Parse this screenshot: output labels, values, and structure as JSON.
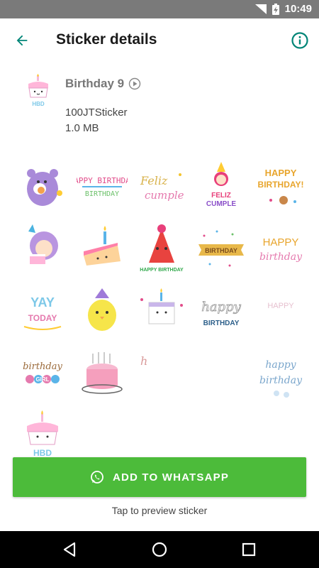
{
  "status_bar": {
    "time": "10:49",
    "icons": [
      "wifi-icon",
      "battery-charging-icon"
    ]
  },
  "app_bar": {
    "title": "Sticker details",
    "back_icon": "arrow-back-icon",
    "info_icon": "info-icon"
  },
  "pack": {
    "name": "Birthday 9",
    "publisher": "100JTSticker",
    "size": "1.0 MB",
    "icon": "hbd-cake-icon"
  },
  "stickers": [
    {
      "name": "sticker-purple-bear"
    },
    {
      "name": "sticker-happy-birthday-rainbow",
      "text": "HAPPY BIRTHDAY"
    },
    {
      "name": "sticker-feliz-cumple-script",
      "text": "Feliz cumple"
    },
    {
      "name": "sticker-girl-feliz-cumple",
      "text": "FELIZ CUMPLE"
    },
    {
      "name": "sticker-happy-birthday-gold",
      "text": "HAPPY BIRTHDAY!"
    },
    {
      "name": "sticker-girl-with-cake"
    },
    {
      "name": "sticker-cake-slice"
    },
    {
      "name": "sticker-party-hat",
      "text": "HAPPY BIRTHDAY"
    },
    {
      "name": "sticker-birthday-banner",
      "text": "BIRTHDAY"
    },
    {
      "name": "sticker-happy-birthday-script",
      "text": "HAPPY birthday"
    },
    {
      "name": "sticker-yay-today",
      "text": "YAY TODAY"
    },
    {
      "name": "sticker-yellow-chick"
    },
    {
      "name": "sticker-cute-cake"
    },
    {
      "name": "sticker-happy-birthday-outline",
      "text": "happy BIRTHDAY"
    },
    {
      "name": "sticker-happy-faint",
      "text": "HAPPY"
    },
    {
      "name": "sticker-birthday-girl",
      "text": "birthday GIRL"
    },
    {
      "name": "sticker-pink-cake-candles"
    },
    {
      "name": "sticker-h-scribble",
      "text": "h"
    },
    {
      "name": "sticker-blank"
    },
    {
      "name": "sticker-happy-birthday-blue",
      "text": "happy birthday"
    },
    {
      "name": "sticker-hbd-cake",
      "text": "HBD"
    }
  ],
  "actions": {
    "add_label": "ADD TO WHATSAPP",
    "add_icon": "whatsapp-icon",
    "hint": "Tap to preview sticker"
  },
  "nav": {
    "icons": [
      "back-triangle-icon",
      "home-circle-icon",
      "recents-square-icon"
    ]
  },
  "colors": {
    "accent": "#008577",
    "button": "#4cbb3a",
    "status_bar": "#7a7a7a"
  }
}
